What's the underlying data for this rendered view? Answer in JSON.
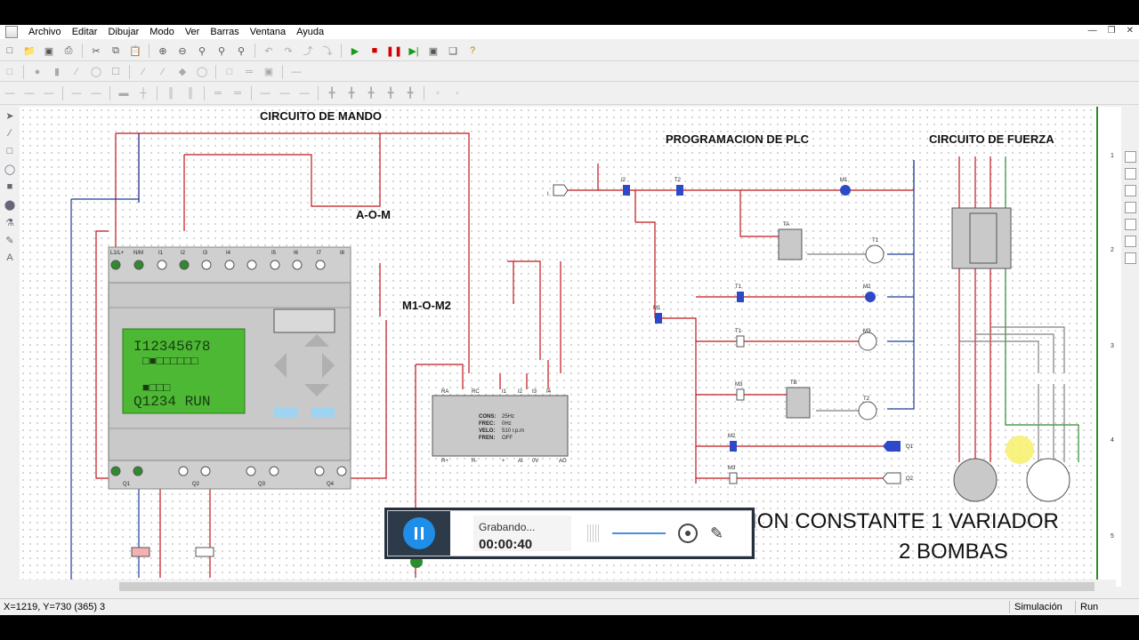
{
  "menu": [
    "Archivo",
    "Editar",
    "Dibujar",
    "Modo",
    "Ver",
    "Barras",
    "Ventana",
    "Ayuda"
  ],
  "titles": {
    "mando": "CIRCUITO DE MANDO",
    "plc": "PROGRAMACION DE PLC",
    "fuerza": "CIRCUITO DE FUERZA",
    "big1": "ION CONSTANTE 1 VARIADOR",
    "big2": "2 BOMBAS"
  },
  "labels": {
    "aom": "A-O-M",
    "m1om2": "M1-O-M2"
  },
  "plc_display": {
    "line1": "I12345678",
    "line2": "□■□□□□□□",
    "line4": "■□□□",
    "line5": "Q1234  RUN"
  },
  "plc_inputs": [
    "L1/L+",
    "N/M",
    "I1",
    "I2",
    "I3",
    "I4",
    "I5",
    "I6",
    "I7",
    "I8"
  ],
  "plc_outputs": [
    "Q1",
    "Q2",
    "Q3",
    "Q4"
  ],
  "vfd": {
    "top": [
      "RA",
      "RC",
      "I1",
      "I2",
      "I3",
      "I4"
    ],
    "bottom": [
      "R+",
      "R-",
      "+",
      "AI",
      "0V",
      "AO"
    ],
    "params": [
      {
        "k": "CONS:",
        "v": "25Hz"
      },
      {
        "k": "FREC:",
        "v": "0Hz"
      },
      {
        "k": "VELO:",
        "v": "510  r.p.m"
      },
      {
        "k": "FREN:",
        "v": "OFF"
      }
    ]
  },
  "ladder": {
    "r1": [
      "I2",
      "T2",
      "M1"
    ],
    "r2": [
      "TA",
      "T1"
    ],
    "r3": [
      "T1",
      "M2"
    ],
    "r4": [
      "T1",
      "M3"
    ],
    "r5": [
      "M3",
      "TB",
      "T2"
    ],
    "r6": [
      "M2",
      "Q1"
    ],
    "r7": [
      "M3",
      "Q2"
    ],
    "m1": "M1",
    "input": "I"
  },
  "recorder": {
    "status": "Grabando...",
    "time": "00:00:40"
  },
  "status": {
    "coords": "X=1219, Y=730 (365) 3",
    "mode": "Simulación",
    "state": "Run"
  },
  "ruler": [
    "1",
    "2",
    "3",
    "4",
    "5"
  ],
  "colors": {
    "wire_red": "#c0161b",
    "wire_blue": "#1e3c96",
    "wire_green": "#2e8b2e",
    "lcd": "#4cb834"
  }
}
